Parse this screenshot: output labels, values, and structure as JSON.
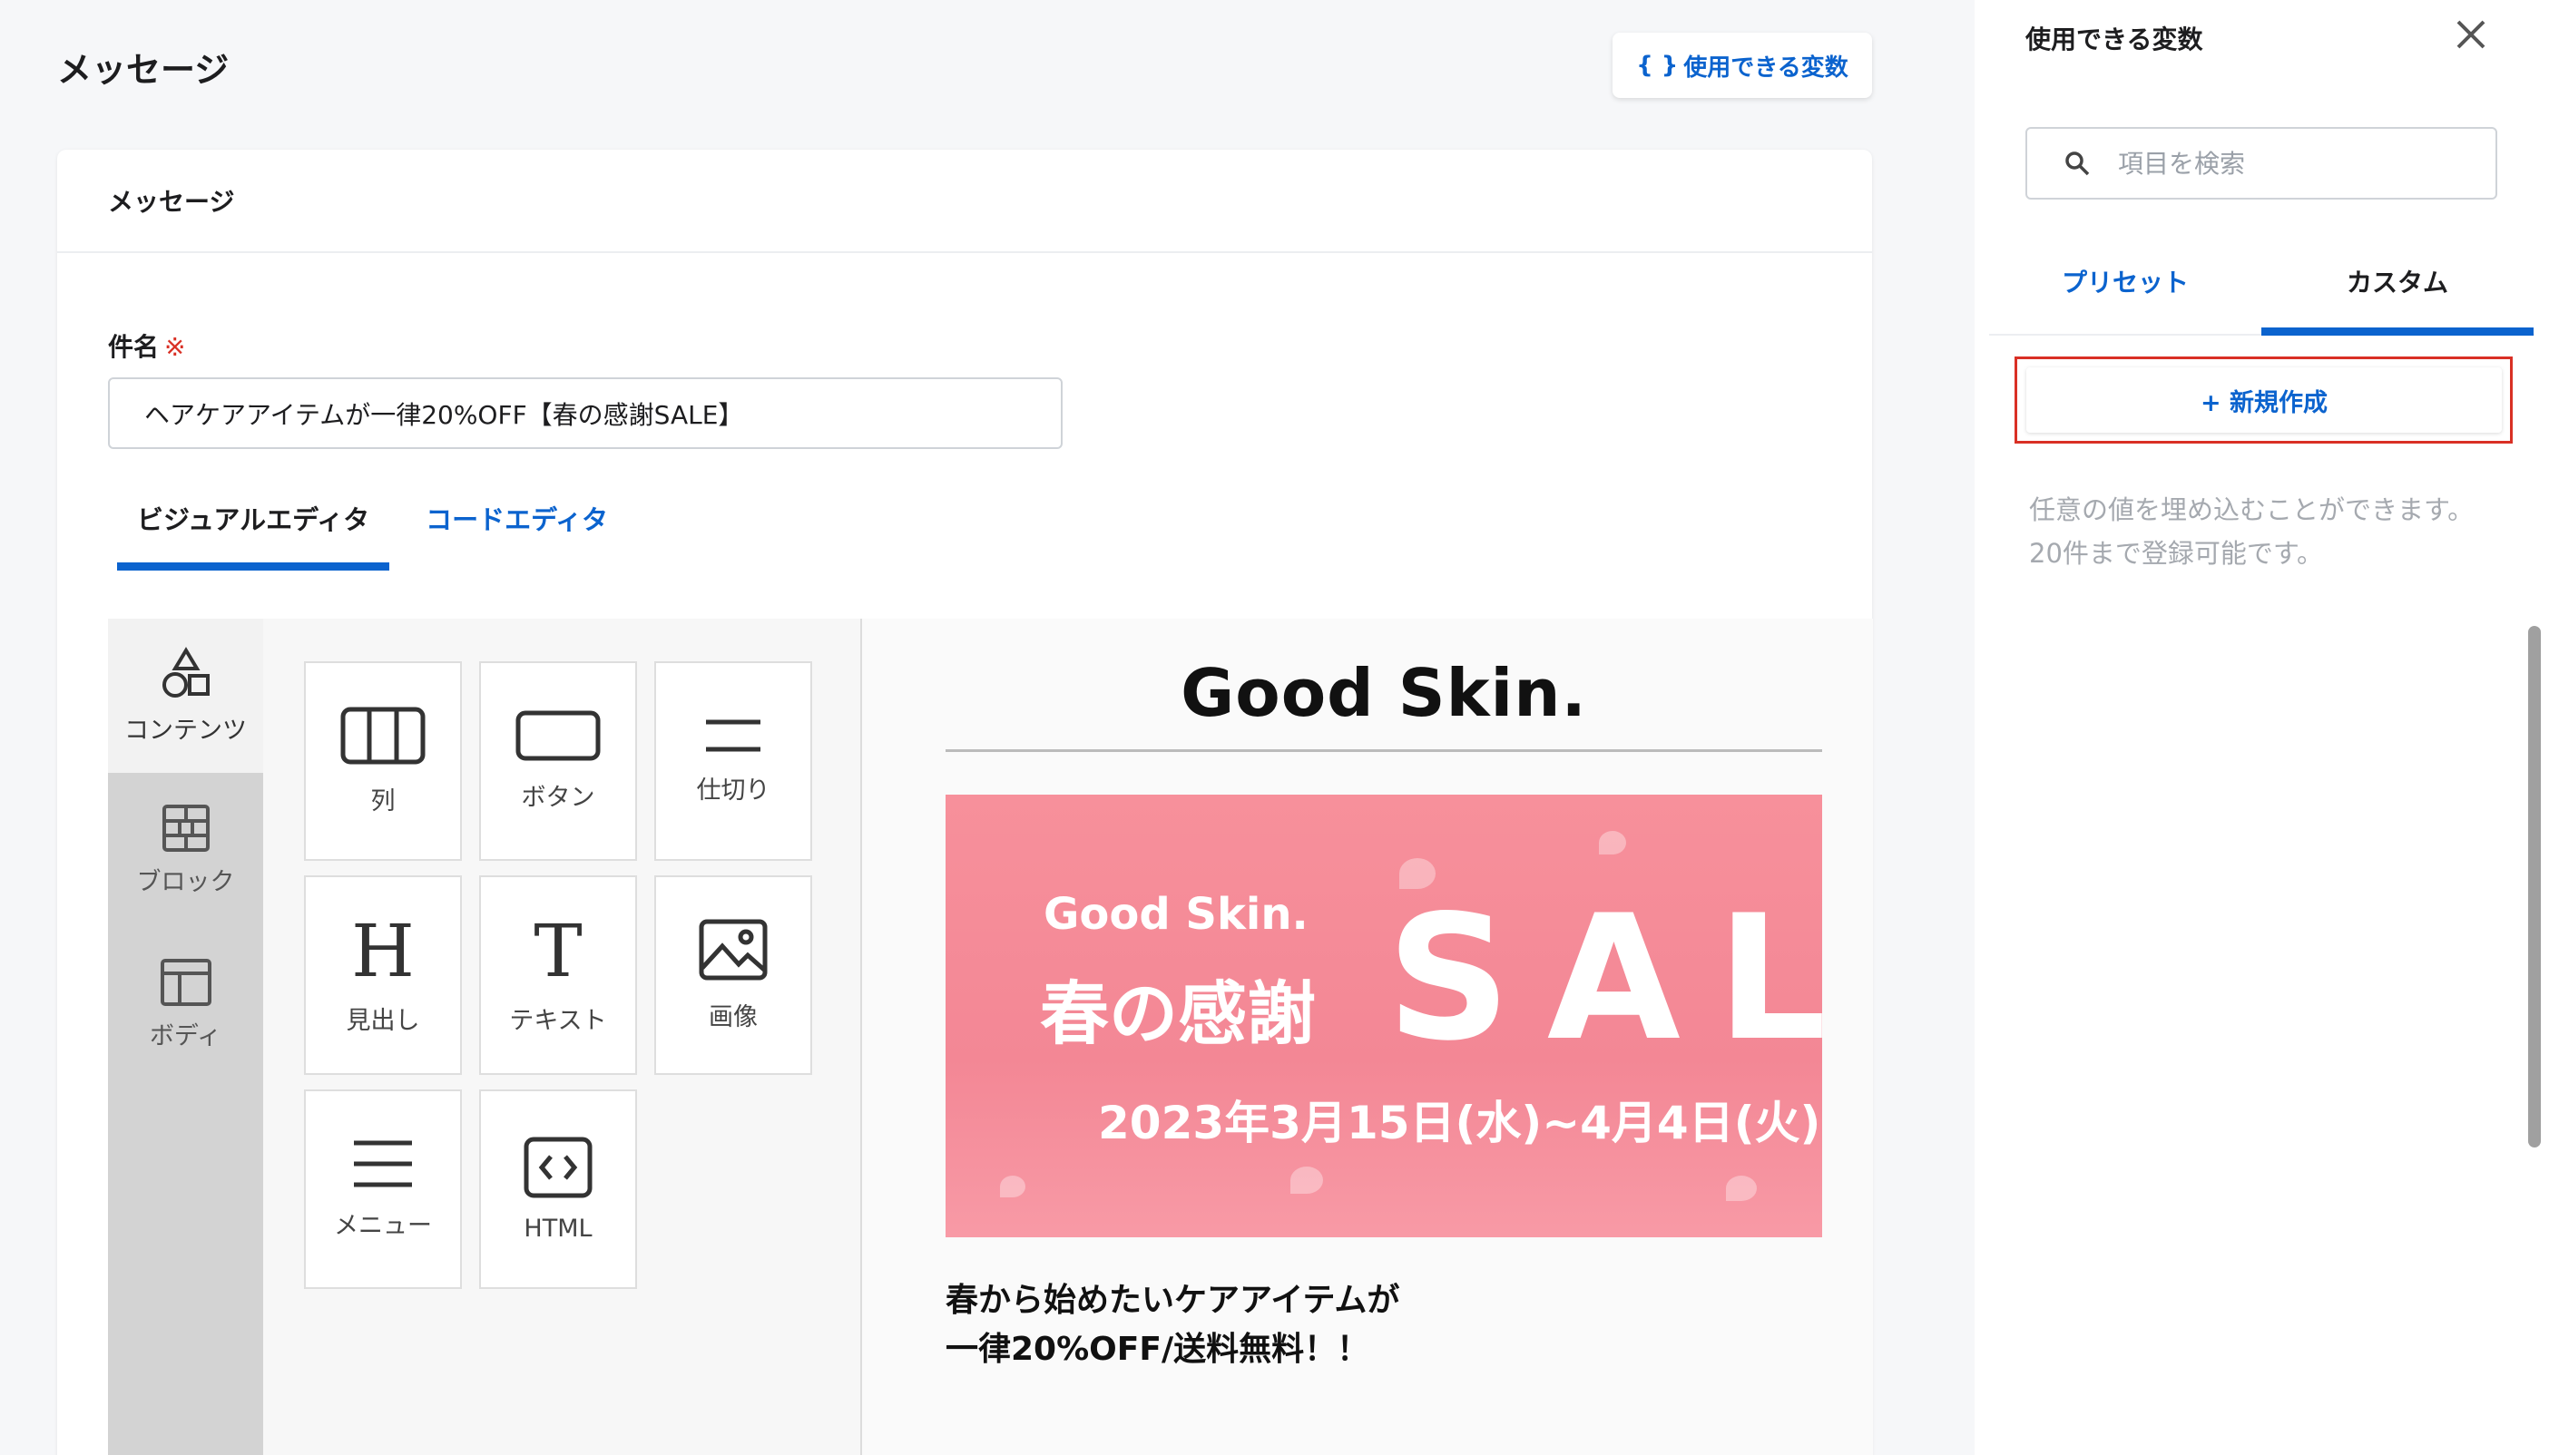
{
  "header": {
    "title": "メッセージ",
    "vars_button_brace": "{ }",
    "vars_button_label": "使用できる変数"
  },
  "card": {
    "title": "メッセージ"
  },
  "subject": {
    "label": "件名",
    "required_mark": "※",
    "value": "ヘアケアアイテムが一律20%OFF【春の感謝SALE】"
  },
  "editor_tabs": [
    {
      "label": "ビジュアルエディタ",
      "active": true
    },
    {
      "label": "コードエディタ",
      "active": false
    }
  ],
  "rail": [
    {
      "label": "コンテンツ",
      "icon": "shapes-icon",
      "active": true
    },
    {
      "label": "ブロック",
      "icon": "blocks-icon"
    },
    {
      "label": "ボディ",
      "icon": "body-layout-icon"
    }
  ],
  "blocks": [
    {
      "label": "列",
      "icon": "columns-icon"
    },
    {
      "label": "ボタン",
      "icon": "button-icon"
    },
    {
      "label": "仕切り",
      "icon": "divider-icon"
    },
    {
      "label": "見出し",
      "icon": "heading-icon",
      "glyph": "H"
    },
    {
      "label": "テキスト",
      "icon": "text-icon",
      "glyph": "T"
    },
    {
      "label": "画像",
      "icon": "image-icon"
    },
    {
      "label": "メニュー",
      "icon": "menu-icon"
    },
    {
      "label": "HTML",
      "icon": "html-code-icon"
    }
  ],
  "preview": {
    "brand": "Good Skin.",
    "banner": {
      "brand": "Good Skin.",
      "title": "春の感謝",
      "sale": "SALE",
      "date": "2023年3月15日(水)~4月4日(火)"
    },
    "copy_line1": "春から始めたいケアアイテムが",
    "copy_line2": "一律20%OFF/送料無料！！"
  },
  "panel": {
    "title": "使用できる変数",
    "search_placeholder": "項目を検索",
    "tabs": [
      {
        "label": "プリセット",
        "active": false
      },
      {
        "label": "カスタム",
        "active": true
      }
    ],
    "new_button": "+ 新規作成",
    "hint_line1": "任意の値を埋め込むことができます。",
    "hint_line2": "20件まで登録可能です。"
  },
  "colors": {
    "accent": "#0b63ce",
    "required": "#d93025",
    "highlight_border": "#d93025",
    "banner": "#f38795"
  }
}
